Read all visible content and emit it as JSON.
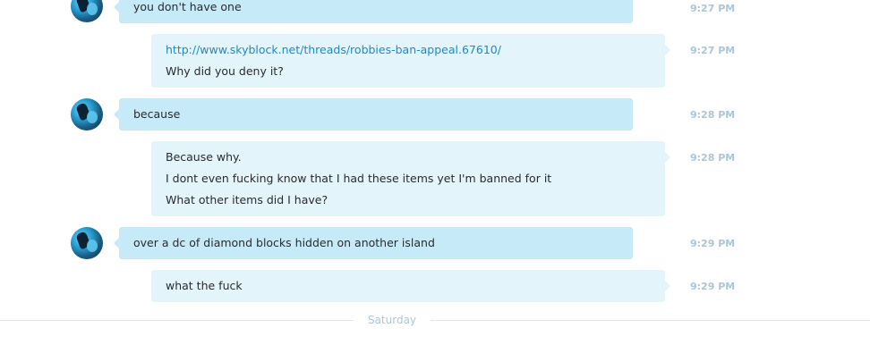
{
  "messages": [
    {
      "id": "m0",
      "sender": "them",
      "lines": [
        "you don't have one"
      ],
      "time": "9:27 PM"
    },
    {
      "id": "m1",
      "sender": "me",
      "link": "http://www.skyblock.net/threads/robbies-ban-appeal.67610/",
      "lines": [
        "Why did you deny it?"
      ],
      "time": "9:27 PM"
    },
    {
      "id": "m2",
      "sender": "them",
      "lines": [
        "because"
      ],
      "time": "9:28 PM"
    },
    {
      "id": "m3",
      "sender": "me",
      "lines": [
        "Because why.",
        "I dont even fucking know that I had these items yet I'm banned for it",
        "What other items did I have?"
      ],
      "time": "9:28 PM"
    },
    {
      "id": "m4",
      "sender": "them",
      "lines": [
        "over a dc of diamond blocks hidden on another island"
      ],
      "time": "9:29 PM"
    },
    {
      "id": "m5",
      "sender": "me",
      "lines": [
        "what the fuck"
      ],
      "time": "9:29 PM"
    }
  ],
  "day_divider": {
    "label": "Saturday"
  },
  "colors": {
    "them_bubble": "#c7eaf9",
    "me_bubble": "#e3f4fb",
    "link": "#1a8ac6",
    "timestamp": "#a9c6d8"
  }
}
